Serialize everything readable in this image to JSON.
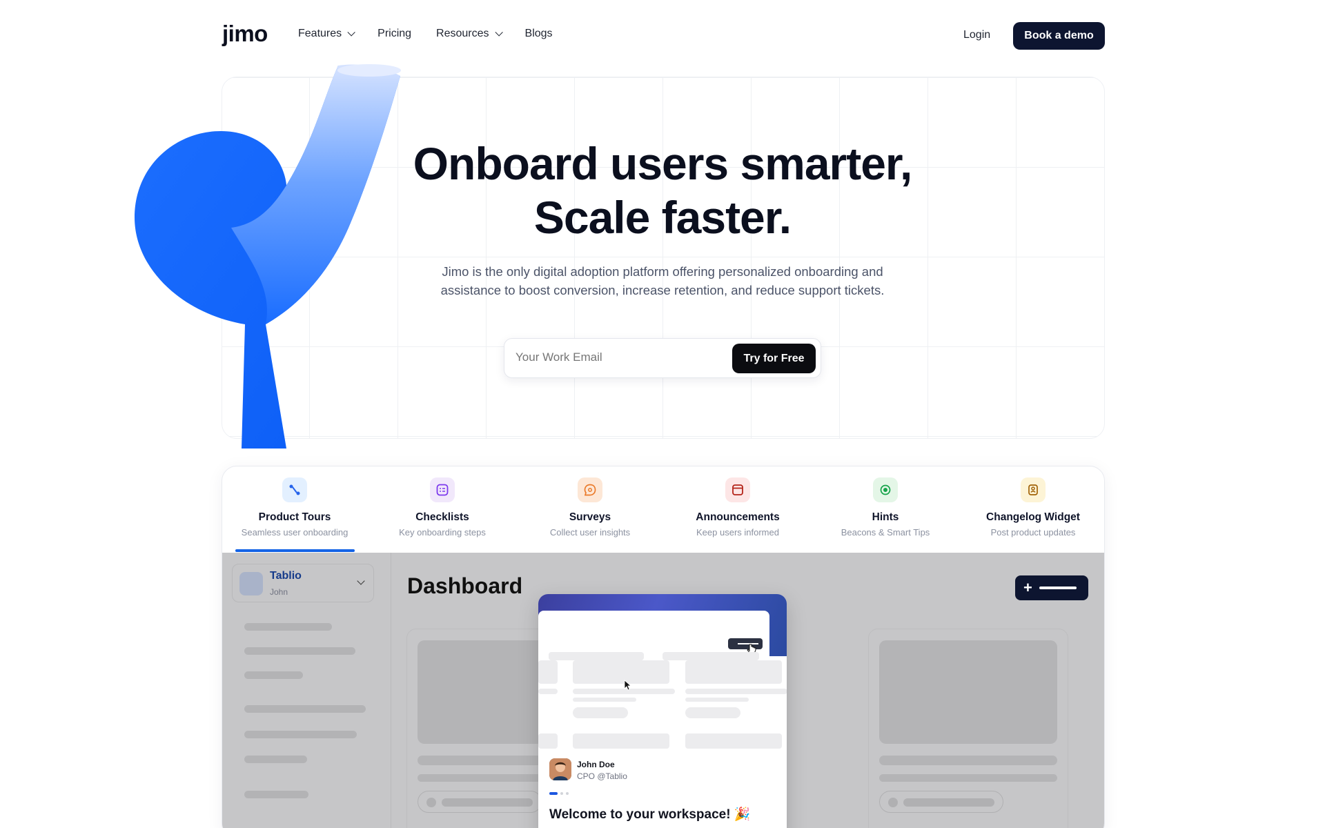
{
  "nav": {
    "logo": "jimo",
    "links": [
      {
        "label": "Features",
        "has_dropdown": true
      },
      {
        "label": "Pricing",
        "has_dropdown": false
      },
      {
        "label": "Resources",
        "has_dropdown": true
      },
      {
        "label": "Blogs",
        "has_dropdown": false
      }
    ],
    "login": "Login",
    "cta": "Book a demo"
  },
  "hero": {
    "title_line1": "Onboard users smarter,",
    "title_line2": "Scale faster.",
    "subtitle": "Jimo is the only digital adoption platform offering personalized onboarding and assistance to boost conversion, increase retention, and reduce support tickets.",
    "email_placeholder": "Your Work Email",
    "cta": "Try for Free"
  },
  "features": {
    "active_index": 0,
    "tabs": [
      {
        "title": "Product Tours",
        "desc": "Seamless user onboarding",
        "icon": "route-icon",
        "color": "#e3f0ff"
      },
      {
        "title": "Checklists",
        "desc": "Key onboarding steps",
        "icon": "checklist-icon",
        "color": "#f1e8fb"
      },
      {
        "title": "Surveys",
        "desc": "Collect user insights",
        "icon": "survey-icon",
        "color": "#fde7d6"
      },
      {
        "title": "Announcements",
        "desc": "Keep users informed",
        "icon": "announcement-icon",
        "color": "#fde6e6"
      },
      {
        "title": "Hints",
        "desc": "Beacons & Smart Tips",
        "icon": "beacon-icon",
        "color": "#e4f6e7"
      },
      {
        "title": "Changelog Widget",
        "desc": "Post product updates",
        "icon": "changelog-icon",
        "color": "#fdf4d6"
      }
    ]
  },
  "demo": {
    "workspace_name": "Tablio",
    "workspace_user": "John",
    "dashboard_title": "Dashboard",
    "popup": {
      "author_name": "John Doe",
      "author_role": "CPO @Tablio",
      "welcome": "Welcome to your workspace! 🎉"
    }
  }
}
